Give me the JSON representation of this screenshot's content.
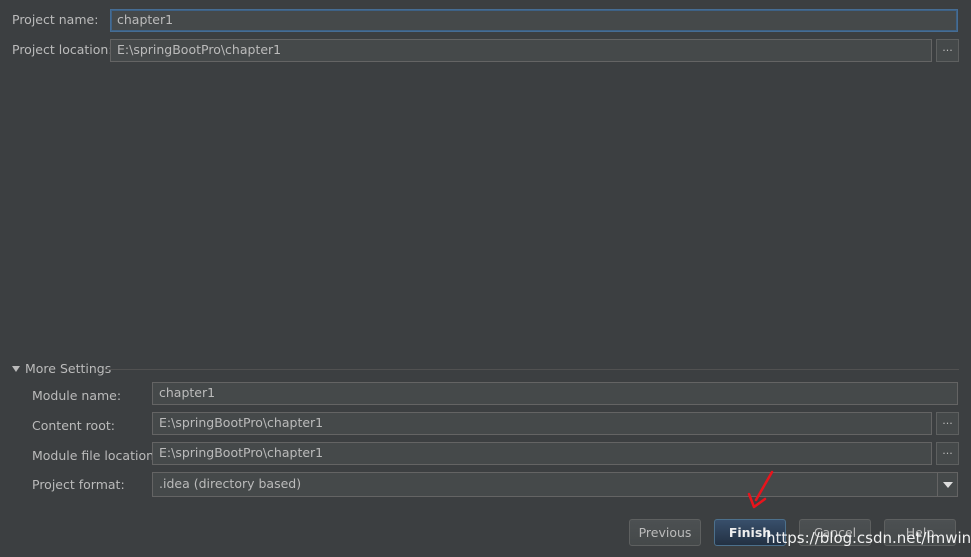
{
  "project": {
    "name_label": "Project name:",
    "name_value": "chapter1",
    "location_label": "Project location:",
    "location_value": "E:\\springBootPro\\chapter1",
    "browse_label": "..."
  },
  "more_settings": {
    "title": "More Settings",
    "module_name_label": "Module name:",
    "module_name_value": "chapter1",
    "content_root_label": "Content root:",
    "content_root_value": "E:\\springBootPro\\chapter1",
    "module_file_label": "Module file location:",
    "module_file_value": "E:\\springBootPro\\chapter1",
    "project_format_label": "Project format:",
    "project_format_value": ".idea (directory based)"
  },
  "buttons": {
    "previous": "Previous",
    "finish": "Finish",
    "cancel": "Cancel",
    "help": "Help"
  },
  "watermark": "https://blog.csdn.net/lmwind",
  "colors": {
    "background": "#3c3f41",
    "annotation_arrow": "#e8141c"
  }
}
